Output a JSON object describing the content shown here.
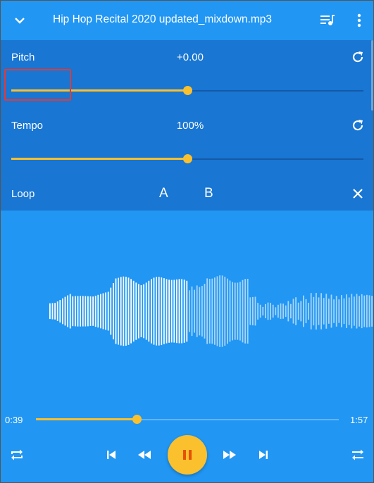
{
  "appbar": {
    "title": "Hip Hop Recital 2020 updated_mixdown.mp3",
    "back_icon": "chevron-down-icon",
    "queue_icon": "queue-music-icon",
    "more_icon": "more-vertical-icon"
  },
  "controls": {
    "pitch": {
      "label": "Pitch",
      "value": "+0.00",
      "level": 0.5,
      "reset_icon": "refresh-icon"
    },
    "tempo": {
      "label": "Tempo",
      "value": "100%",
      "level": 0.5,
      "reset_icon": "refresh-icon"
    },
    "loop": {
      "label": "Loop",
      "a_label": "A",
      "b_label": "B",
      "close_icon": "close-icon"
    }
  },
  "playback": {
    "current_time": "0:39",
    "total_time": "1:57",
    "progress": 0.333,
    "state": "playing"
  },
  "colors": {
    "background": "#2196f3",
    "panel": "#1976d2",
    "accent": "#fbc02d",
    "highlight_box": "#e53935"
  },
  "transport": {
    "repeat_icon": "repeat-icon",
    "previous_icon": "skip-previous-icon",
    "rewind_icon": "rewind-icon",
    "pause_icon": "pause-icon",
    "forward_icon": "fast-forward-icon",
    "next_icon": "skip-next-icon",
    "ab_repeat_icon": "ab-repeat-icon"
  }
}
